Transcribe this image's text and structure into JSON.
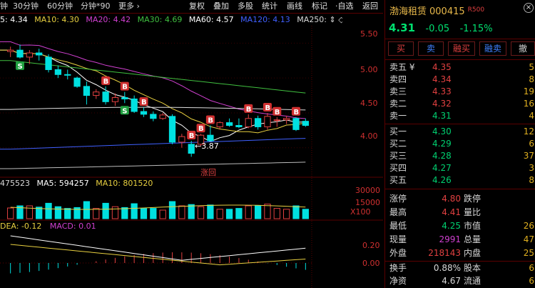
{
  "toolbar": {
    "items": [
      "钟",
      "30分钟",
      "60分钟",
      "分钟*90",
      "更多 ›"
    ],
    "buttons": [
      "复权",
      "叠加",
      "多股",
      "统计",
      "画线",
      "·自选",
      "返回"
    ]
  },
  "ma_line": {
    "ma5": "5: 4.34",
    "ma10": "MA10: 4.30",
    "ma20": "MA20: 4.42",
    "ma30": "MA30: 4.69",
    "ma60": "MA60: 4.57",
    "ma120": "MA120: 4.13",
    "ma250": "MA250: ⇕ ◇"
  },
  "price_axis": [
    "5.50",
    "5.00",
    "4.50",
    "4.00"
  ],
  "low_marker": "←3.87",
  "zhanghui": "涨回",
  "vol_line": {
    "vol": "475523",
    "ma5": "MA5: 594257",
    "ma10": "MA10: 801520"
  },
  "vol_axis": [
    "30000",
    "15000",
    "X100"
  ],
  "ind_line": {
    "dea": "DEA: -0.12",
    "macd": "MACD: 0.01"
  },
  "ind_axis": [
    "0.20",
    "0.00"
  ],
  "colors": {
    "up": "#e04040",
    "down": "#00e0e0",
    "ma5": "#ffffff",
    "ma10": "#e8d040",
    "ma20": "#d040d0",
    "ma30": "#40c040",
    "ma60": "#ffffff",
    "ma120": "#4060ff"
  },
  "chart_data": {
    "type": "candlestick",
    "note_rows": "Approximate daily OHLC read from the chart (oldest to newest)",
    "candles": [
      {
        "o": 5.38,
        "h": 5.45,
        "l": 5.3,
        "c": 5.4
      },
      {
        "o": 5.4,
        "h": 5.48,
        "l": 5.28,
        "c": 5.3
      },
      {
        "o": 5.3,
        "h": 5.4,
        "l": 5.2,
        "c": 5.36
      },
      {
        "o": 5.36,
        "h": 5.42,
        "l": 5.25,
        "c": 5.33
      },
      {
        "o": 5.3,
        "h": 5.34,
        "l": 5.08,
        "c": 5.12
      },
      {
        "o": 5.12,
        "h": 5.18,
        "l": 5.0,
        "c": 5.05
      },
      {
        "o": 5.05,
        "h": 5.12,
        "l": 4.98,
        "c": 5.04
      },
      {
        "o": 5.0,
        "h": 5.02,
        "l": 4.86,
        "c": 4.88
      },
      {
        "o": 4.88,
        "h": 4.95,
        "l": 4.62,
        "c": 4.75
      },
      {
        "o": 4.75,
        "h": 4.84,
        "l": 4.7,
        "c": 4.8
      },
      {
        "o": 4.8,
        "h": 4.88,
        "l": 4.62,
        "c": 4.66
      },
      {
        "o": 4.66,
        "h": 4.78,
        "l": 4.6,
        "c": 4.72
      },
      {
        "o": 4.72,
        "h": 4.8,
        "l": 4.64,
        "c": 4.7
      },
      {
        "o": 4.7,
        "h": 4.75,
        "l": 4.5,
        "c": 4.52
      },
      {
        "o": 4.52,
        "h": 4.58,
        "l": 4.44,
        "c": 4.48
      },
      {
        "o": 4.48,
        "h": 4.52,
        "l": 4.38,
        "c": 4.42
      },
      {
        "o": 4.42,
        "h": 4.5,
        "l": 4.4,
        "c": 4.47
      },
      {
        "o": 4.45,
        "h": 4.48,
        "l": 4.05,
        "c": 4.08
      },
      {
        "o": 4.08,
        "h": 4.2,
        "l": 4.0,
        "c": 4.16
      },
      {
        "o": 4.05,
        "h": 4.1,
        "l": 3.87,
        "c": 3.92
      },
      {
        "o": 4.05,
        "h": 4.2,
        "l": 4.02,
        "c": 4.18
      },
      {
        "o": 4.18,
        "h": 4.32,
        "l": 4.1,
        "c": 4.1
      },
      {
        "o": 4.3,
        "h": 4.38,
        "l": 4.26,
        "c": 4.36
      },
      {
        "o": 4.36,
        "h": 4.42,
        "l": 4.3,
        "c": 4.32
      },
      {
        "o": 4.32,
        "h": 4.42,
        "l": 4.28,
        "c": 4.3
      },
      {
        "o": 4.3,
        "h": 4.48,
        "l": 4.28,
        "c": 4.42
      },
      {
        "o": 4.42,
        "h": 4.46,
        "l": 4.26,
        "c": 4.3
      },
      {
        "o": 4.3,
        "h": 4.5,
        "l": 4.26,
        "c": 4.45
      },
      {
        "o": 4.4,
        "h": 4.44,
        "l": 4.3,
        "c": 4.4
      },
      {
        "o": 4.4,
        "h": 4.46,
        "l": 4.34,
        "c": 4.42
      },
      {
        "o": 4.42,
        "h": 4.44,
        "l": 4.24,
        "c": 4.26
      },
      {
        "o": 4.38,
        "h": 4.42,
        "l": 4.3,
        "c": 4.32
      }
    ],
    "ylim": [
      3.7,
      5.75
    ],
    "signals_b": [
      10,
      12,
      14,
      19,
      20,
      21,
      25,
      27,
      28,
      30
    ],
    "signals_s": [
      1,
      12
    ]
  },
  "panel": {
    "name": "渤海租赁",
    "code": "000415",
    "tag": "R500",
    "price": "4.31",
    "change": "-0.05",
    "pct": "-1.15%",
    "trade_buttons": [
      "买",
      "卖",
      "融买",
      "融卖",
      "撤"
    ],
    "sells": [
      {
        "label": "卖五 ¥",
        "price": "4.35",
        "vol": "5"
      },
      {
        "label": "卖四",
        "price": "4.34",
        "vol": "8"
      },
      {
        "label": "卖三",
        "price": "4.33",
        "vol": "19"
      },
      {
        "label": "卖二",
        "price": "4.32",
        "vol": "16"
      },
      {
        "label": "卖一",
        "price": "4.31",
        "vol": "4"
      }
    ],
    "buys": [
      {
        "label": "买一",
        "price": "4.30",
        "vol": "12"
      },
      {
        "label": "买二",
        "price": "4.29",
        "vol": "6"
      },
      {
        "label": "买三",
        "price": "4.28",
        "vol": "37"
      },
      {
        "label": "买四",
        "price": "4.27",
        "vol": "3"
      },
      {
        "label": "买五",
        "price": "4.26",
        "vol": "8"
      }
    ],
    "stats": [
      {
        "l1": "涨停",
        "v1": "4.80",
        "c1": "red",
        "l2": "跌停",
        "v2": ""
      },
      {
        "l1": "最高",
        "v1": "4.41",
        "c1": "red",
        "l2": "量比",
        "v2": ""
      },
      {
        "l1": "最低",
        "v1": "4.25",
        "c1": "green",
        "l2": "市值",
        "v2": "26"
      },
      {
        "l1": "现量",
        "v1": "2991",
        "c1": "mag",
        "l2": "总量",
        "v2": "47"
      },
      {
        "l1": "外盘",
        "v1": "218143",
        "c1": "red",
        "l2": "内盘",
        "v2": "25"
      }
    ],
    "stats2": [
      {
        "l1": "换手",
        "v1": "0.88%",
        "c1": "wht",
        "l2": "股本",
        "v2": "6"
      },
      {
        "l1": "净资",
        "v1": "4.67",
        "c1": "wht",
        "l2": "流通",
        "v2": "6"
      }
    ]
  }
}
